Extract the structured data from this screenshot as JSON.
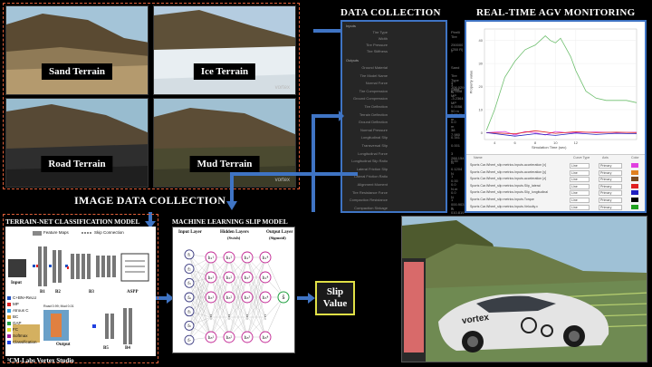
{
  "terrain_tiles": [
    {
      "label": "Sand Terrain"
    },
    {
      "label": "Ice Terrain",
      "watermark": "vortex"
    },
    {
      "label": "Road Terrain"
    },
    {
      "label": "Mud Terrain",
      "watermark": "vortex"
    }
  ],
  "headings": {
    "image_collection": "IMAGE DATA COLLECTION",
    "data_collection": "DATA COLLECTION",
    "monitoring": "REAL-TIME AGV MONITORING",
    "terrain_net": "TERRAIN-NET CLASSIFICATION MODEL",
    "ml_slip": "MACHINE LEARNING SLIP MODEL",
    "credit": "¹CM-Labs Vortex Studio"
  },
  "slip_output": {
    "line1": "Slip",
    "line2": "Value"
  },
  "data_panel": {
    "inputs_header": "Inputs",
    "outputs_header": "Outputs",
    "input_rows": [
      {
        "key": "Tire Type",
        "value": "Pirelli Tire"
      },
      {
        "key": "Width",
        "value": ""
      },
      {
        "key": "Tire Pressure",
        "value": "250000 (250 R)"
      },
      {
        "key": "Tire Stiffness",
        "value": "7"
      }
    ],
    "output_rows": [
      {
        "key": "Ground Material",
        "value": "Sand"
      },
      {
        "key": "Tire Model Name",
        "value": "Tire Type 1 Sand"
      },
      {
        "key": "Normal Force",
        "value": "3 706.029 N"
      },
      {
        "key": "Tire Compression",
        "value": "0.7808 MP"
      },
      {
        "key": "Ground Compression",
        "value": "-3.2364 MP"
      },
      {
        "key": "Tire Deflection",
        "value": "0.0056 50 m"
      },
      {
        "key": "Terrain Deflection",
        "value": "0.0141 m"
      },
      {
        "key": "Ground Deflection",
        "value": "0.0 m"
      },
      {
        "key": "Normal Pressure",
        "value": "38 7.980"
      },
      {
        "key": "Longitudinal Slip",
        "value": "0.341"
      },
      {
        "key": "Transversal Slip",
        "value": "0.001"
      },
      {
        "key": "Longitudinal Force",
        "value": "3 288.154 N"
      },
      {
        "key": "Longitudinal Slip Ratio",
        "value": "0.00"
      },
      {
        "key": "Lateral Friction Slip",
        "value": "0.1204 N"
      },
      {
        "key": "Lateral Friction Ratio",
        "value": "1 0.00"
      },
      {
        "key": "Alignment Moment",
        "value": "0.0 N.m"
      },
      {
        "key": "Tire Resistance Force",
        "value": "0.0 N"
      },
      {
        "key": "Compaction Resistance",
        "value": "1 000.903 N"
      },
      {
        "key": "Compaction Sinkage",
        "value": "1 010.819 N"
      }
    ]
  },
  "monitor": {
    "xlabel": "Simulation Time (sec)",
    "ylabel": "Property value",
    "legend_headers": [
      "Name",
      "Curve Type",
      "Axis",
      "Color"
    ],
    "legend_rows": [
      {
        "name": "Sports Car.Wheel_slip metrics.Inputs.acceleration [x]",
        "type": "Line",
        "axis": "Primary",
        "color": "#e040e0"
      },
      {
        "name": "Sports Car.Wheel_slip metrics.Inputs.acceleration [y]",
        "type": "Line",
        "axis": "Primary",
        "color": "#e08020"
      },
      {
        "name": "Sports Car.Wheel_slip metrics.Inputs.acceleration [z]",
        "type": "Line",
        "axis": "Primary",
        "color": "#7a4a20"
      },
      {
        "name": "Sports Car.Wheel_slip metrics.Inputs.Slip_lateral",
        "type": "Line",
        "axis": "Primary",
        "color": "#e02020"
      },
      {
        "name": "Sports Car.Wheel_slip metrics.Inputs.Slip_longitudinal",
        "type": "Line",
        "axis": "Primary",
        "color": "#2020c0"
      },
      {
        "name": "Sports Car.Wheel_slip metrics.Inputs.Torque",
        "type": "Line",
        "axis": "Primary",
        "color": "#000000"
      },
      {
        "name": "Sports Car.Wheel_slip metrics.Inputs.Velocity.x",
        "type": "Line",
        "axis": "Primary",
        "color": "#20a020"
      }
    ]
  },
  "chart_data": {
    "type": "line",
    "xlabel": "Simulation Time (sec)",
    "ylabel": "Property value",
    "xlim": [
      3,
      18
    ],
    "ylim": [
      -3,
      45
    ],
    "xticks": [
      4,
      6,
      8,
      10,
      12
    ],
    "yticks": [
      0,
      10,
      20,
      30,
      40
    ],
    "series": [
      {
        "color": "#6fbf6f",
        "x": [
          3.2,
          4,
          5,
          6,
          7,
          7.5,
          8,
          8.5,
          9,
          9.5,
          10,
          10.5,
          11,
          11.5,
          12,
          13,
          14,
          15,
          16,
          17,
          18
        ],
        "y": [
          1,
          10,
          24,
          31,
          36,
          37,
          38,
          40,
          42,
          40,
          39,
          41,
          37,
          33,
          27,
          18,
          15,
          14,
          14,
          14,
          13
        ]
      },
      {
        "color": "#e040e0",
        "x": [
          3.2,
          5,
          6,
          7,
          8,
          9,
          10,
          11,
          12,
          14,
          16,
          18
        ],
        "y": [
          0,
          0.5,
          -1,
          0.5,
          0,
          -1,
          0.5,
          0,
          0,
          0.3,
          0,
          0.2
        ]
      },
      {
        "color": "#e02020",
        "x": [
          3.2,
          6,
          8,
          10,
          12,
          14,
          16,
          18
        ],
        "y": [
          0,
          -0.5,
          0.8,
          -0.3,
          0.4,
          0,
          0.2,
          0
        ]
      },
      {
        "color": "#2020c0",
        "x": [
          3.2,
          6,
          8,
          10,
          12,
          14,
          16,
          18
        ],
        "y": [
          0,
          -1.5,
          -0.5,
          -1.2,
          -0.2,
          -0.8,
          -0.3,
          -0.5
        ]
      }
    ]
  },
  "terrain_net": {
    "feature_maps": "Feature Maps",
    "skip": "Skip Connection",
    "input_label": "Input",
    "output_label": "Output",
    "blocks": [
      "B1",
      "B2",
      "B3",
      "ASPP",
      "B5",
      "B4"
    ],
    "legend": [
      {
        "label": "C+BN+ReLU",
        "color": "#2050c0"
      },
      {
        "label": "MP",
        "color": "#e02020"
      },
      {
        "label": "Atrous C",
        "color": "#3aa0e0"
      },
      {
        "label": "BC",
        "color": "#e0a020"
      },
      {
        "label": "GAP",
        "color": "#20a040"
      },
      {
        "label": "FC",
        "color": "#e0e020"
      },
      {
        "label": "Softmax",
        "color": "#a020a0"
      },
      {
        "label": "Classification",
        "color": "#2040e0"
      }
    ],
    "decoder_note": "Road 0.99; Mud 0.01"
  },
  "mlp": {
    "input_layer": "Input Layer",
    "hidden_layers": "Hidden Layers",
    "hidden_sub": "(Swish)",
    "output_layer": "Output Layer",
    "output_sub": "(Sigmoid)",
    "inputs": [
      "f₁",
      "f₂",
      "f₃",
      "f₄",
      "f₅",
      "f₆",
      "f₇"
    ],
    "h1": [
      "h₁¹",
      "h₂¹",
      "h₃¹",
      "⋮",
      "h₈¹"
    ],
    "h2": [
      "h₁²",
      "h₂²",
      "h₃²",
      "⋮",
      "h₈²"
    ],
    "h3": [
      "h₁³",
      "h₂³",
      "h₃³",
      "⋮",
      "h₈³"
    ],
    "h4": [
      "h₁⁴",
      "h₂⁴",
      "h₃⁴",
      "⋮",
      "h₈⁴"
    ],
    "output": "ŝ"
  },
  "car": {
    "decal": "vortex"
  }
}
